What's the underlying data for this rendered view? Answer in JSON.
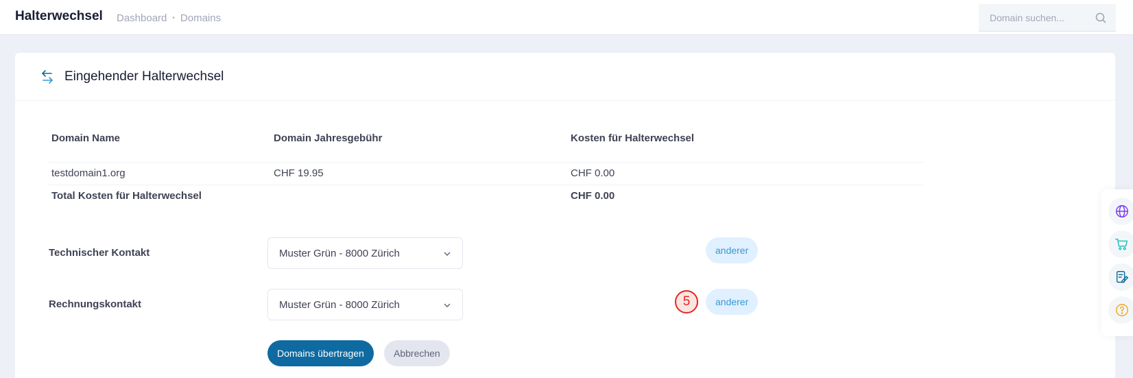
{
  "header": {
    "title": "Halterwechsel",
    "breadcrumb": [
      "Dashboard",
      "Domains"
    ],
    "breadcrumb_separator": "•",
    "search_placeholder": "Domain suchen..."
  },
  "card": {
    "title": "Eingehender Halterwechsel",
    "icon": "swap-arrows-icon"
  },
  "table": {
    "columns": [
      "Domain Name",
      "Domain Jahresgebühr",
      "Kosten für Halterwechsel"
    ],
    "rows": [
      [
        "testdomain1.org",
        "CHF 19.95",
        "CHF 0.00"
      ]
    ],
    "total": {
      "label": "Total Kosten für Halterwechsel",
      "value": "CHF 0.00"
    }
  },
  "contacts": [
    {
      "label": "Technischer Kontakt",
      "selected": "Muster Grün - 8000 Zürich",
      "other_button": "anderer"
    },
    {
      "label": "Rechnungskontakt",
      "selected": "Muster Grün - 8000 Zürich",
      "other_button": "anderer"
    }
  ],
  "marker": {
    "label": "5",
    "color": "#e3261f"
  },
  "actions": {
    "submit": "Domains übertragen",
    "cancel": "Abbrechen"
  },
  "colors": {
    "primary": "#0e6aa1",
    "light_button": "#e1f0ff",
    "light_button_text": "#3699d5"
  },
  "side_dock": {
    "items": [
      "globe-icon",
      "cart-icon",
      "edit-document-icon",
      "help-icon"
    ]
  }
}
